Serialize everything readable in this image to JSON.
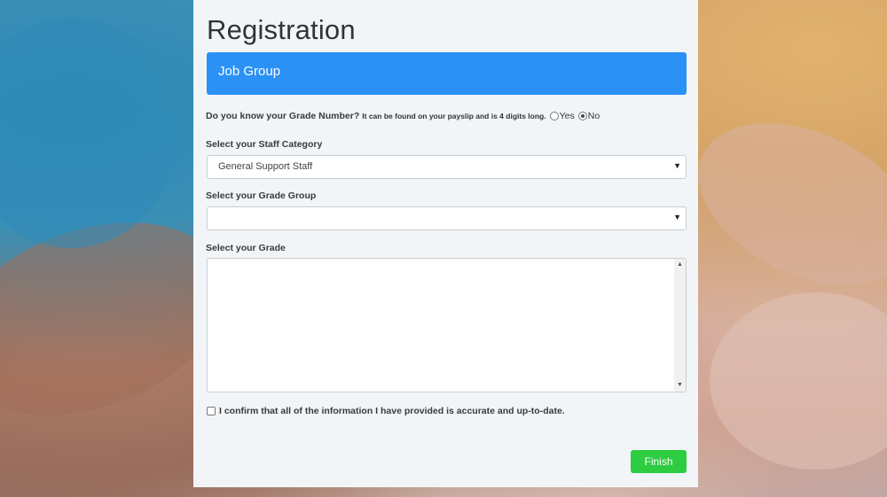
{
  "page": {
    "title": "Registration"
  },
  "section": {
    "heading": "Job Group"
  },
  "grade_question": {
    "question": "Do you know your Grade Number?",
    "hint": "It can be found on your payslip and is 4 digits long.",
    "options": [
      {
        "label": "Yes",
        "checked": false
      },
      {
        "label": "No",
        "checked": true
      }
    ]
  },
  "staff_category": {
    "label": "Select your Staff Category",
    "value": "General Support Staff"
  },
  "grade_group": {
    "label": "Select your Grade Group",
    "value": ""
  },
  "grade": {
    "label": "Select your Grade",
    "options": []
  },
  "confirm": {
    "text": "I confirm that all of the information I have provided is accurate and up-to-date.",
    "checked": false
  },
  "actions": {
    "finish_label": "Finish"
  },
  "colors": {
    "banner": "#2b91f5",
    "finish_button": "#2ecc40",
    "panel": "#f1f5f8"
  }
}
